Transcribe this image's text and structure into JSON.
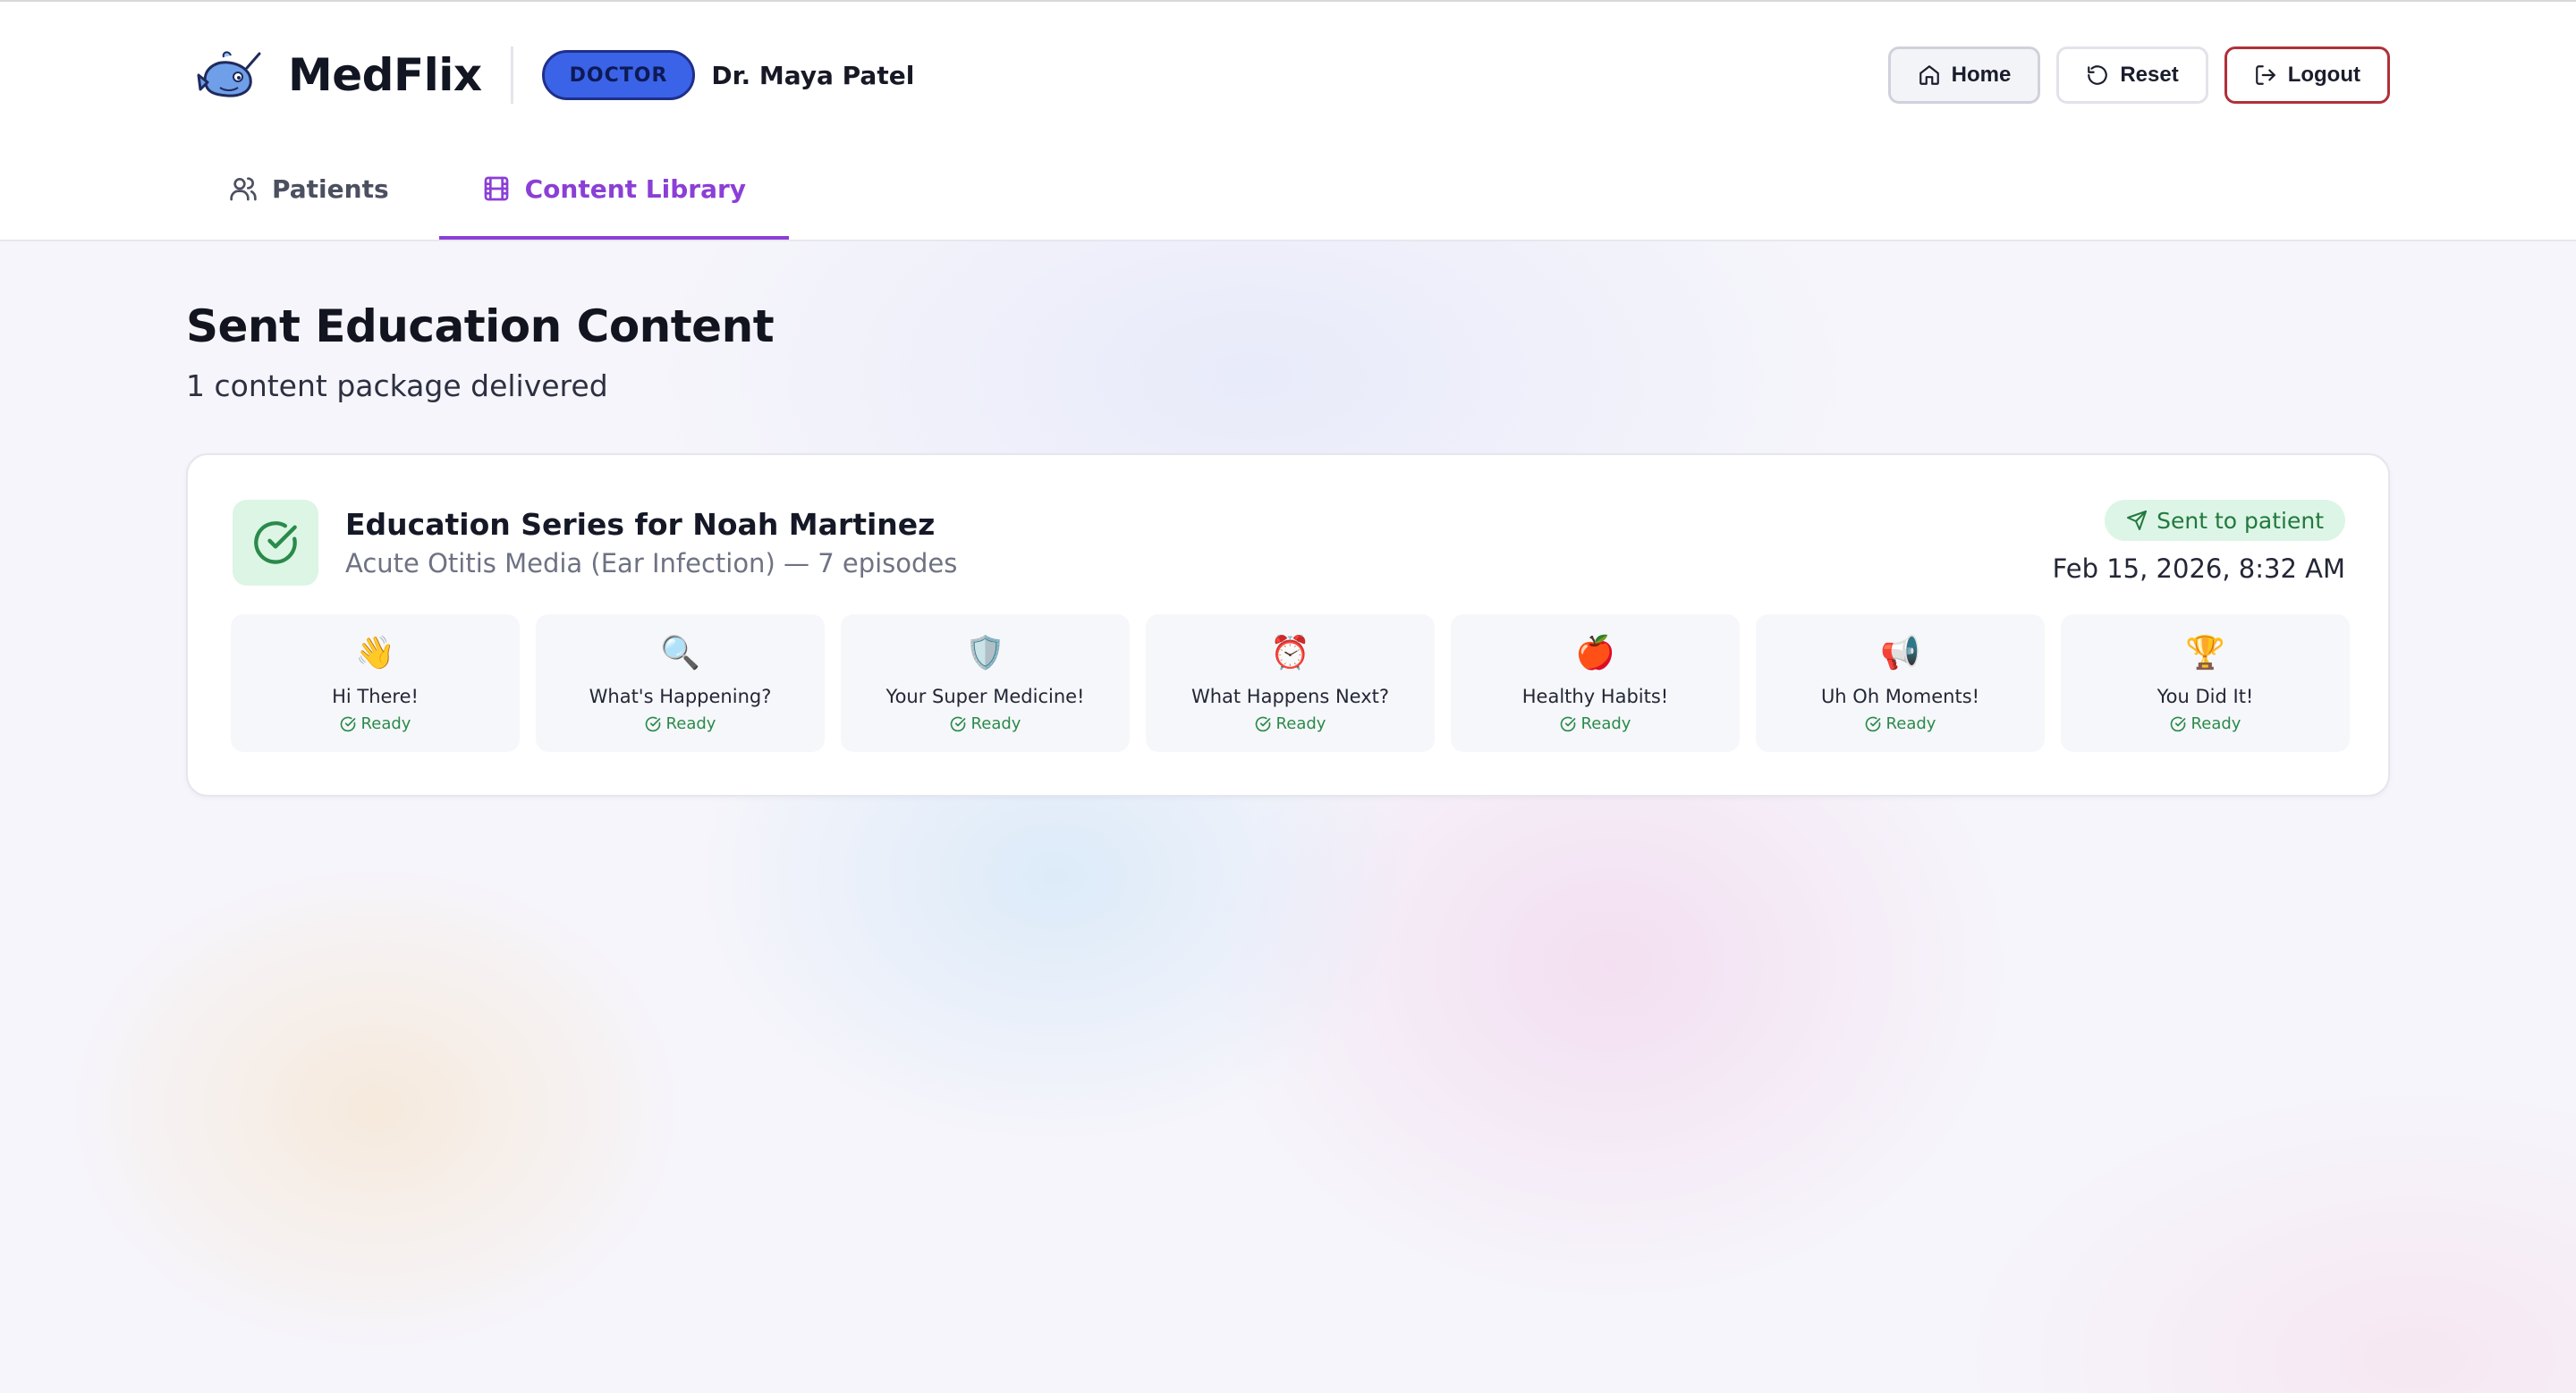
{
  "app": {
    "name": "MedFlix",
    "role_badge": "DOCTOR",
    "user_name": "Dr. Maya Patel"
  },
  "header": {
    "actions": {
      "home": "Home",
      "reset": "Reset",
      "logout": "Logout"
    },
    "tabs": [
      {
        "label": "Patients",
        "icon": "users-icon",
        "active": false
      },
      {
        "label": "Content Library",
        "icon": "film-icon",
        "active": true
      }
    ]
  },
  "page": {
    "title": "Sent Education Content",
    "subtitle": "1 content package delivered"
  },
  "package": {
    "title": "Education Series for Noah Martinez",
    "subtitle": "Acute Otitis Media (Ear Infection) — 7 episodes",
    "status": "Sent to patient",
    "date": "Feb 15, 2026, 8:32 AM",
    "episodes": [
      {
        "emoji": "👋",
        "title": "Hi There!",
        "status": "Ready"
      },
      {
        "emoji": "🔍",
        "title": "What's Happening?",
        "status": "Ready"
      },
      {
        "emoji": "🛡️",
        "title": "Your Super Medicine!",
        "status": "Ready"
      },
      {
        "emoji": "⏰",
        "title": "What Happens Next?",
        "status": "Ready"
      },
      {
        "emoji": "🍎",
        "title": "Healthy Habits!",
        "status": "Ready"
      },
      {
        "emoji": "📢",
        "title": "Uh Oh Moments!",
        "status": "Ready"
      },
      {
        "emoji": "🏆",
        "title": "You Did It!",
        "status": "Ready"
      }
    ]
  },
  "colors": {
    "accent": "#8b3fd6",
    "role_badge": "#3b63e8",
    "success": "#2a8a4a",
    "logout_border": "#b03038"
  }
}
